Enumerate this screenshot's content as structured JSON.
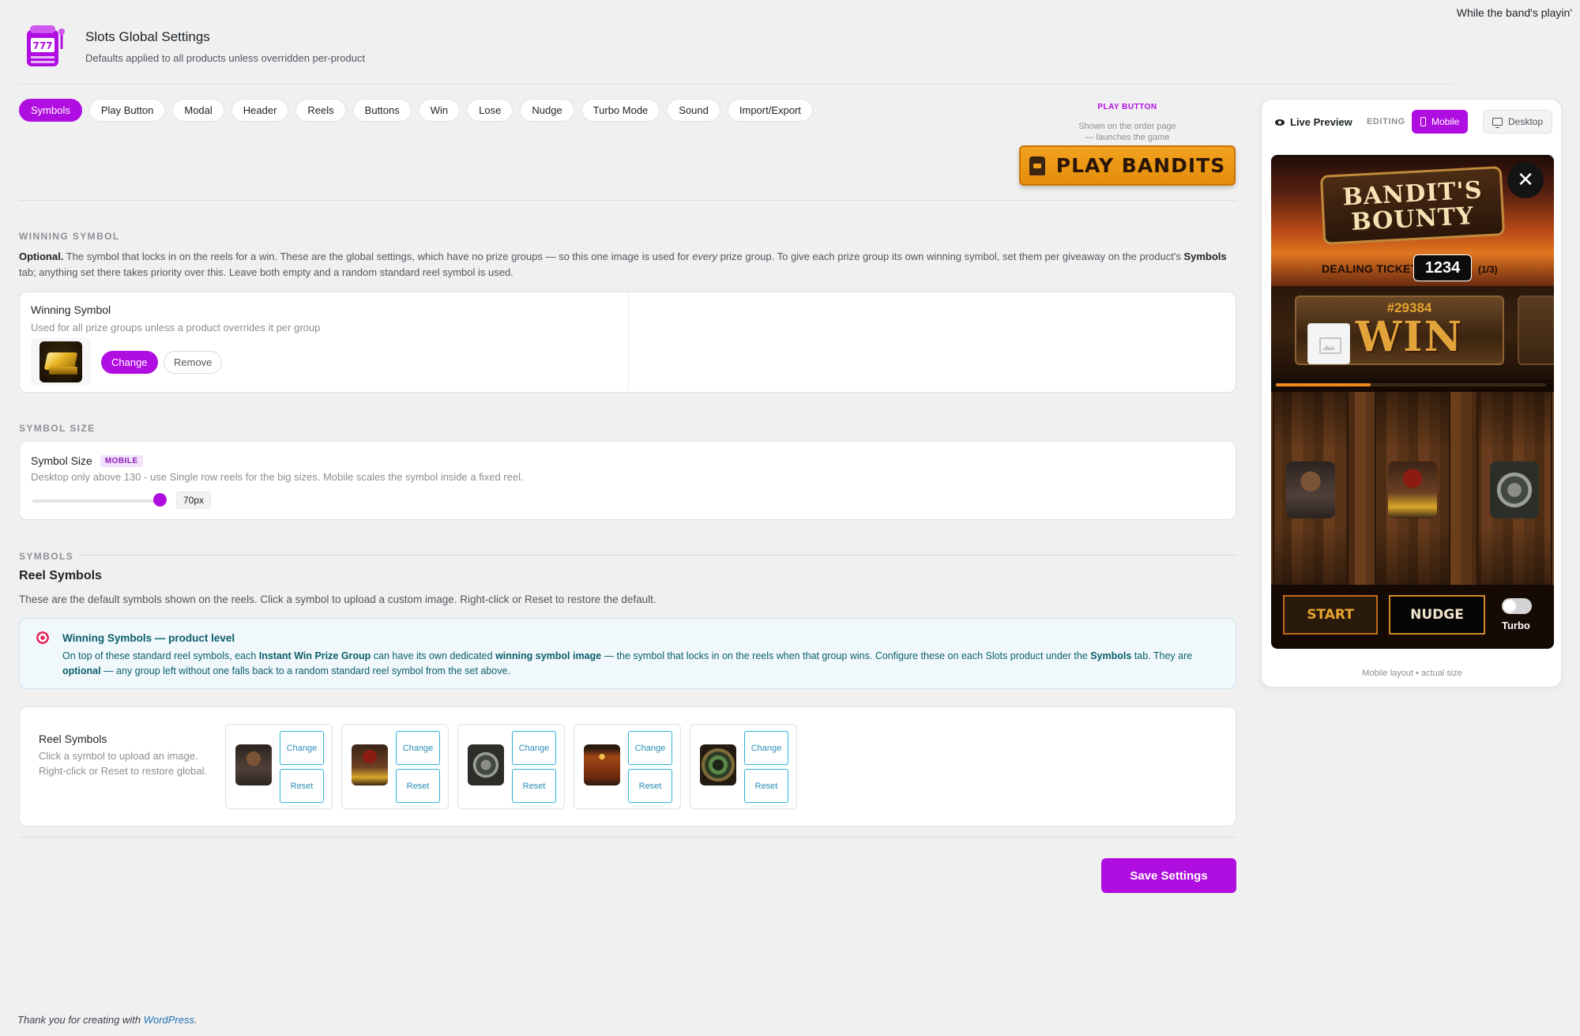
{
  "top_right_text": "While the band's playin'",
  "header": {
    "title": "Slots Global Settings",
    "subtitle": "Defaults applied to all products unless overridden per-product",
    "logo_icon": "slot-machine-icon",
    "logo_digits": "777"
  },
  "tabs": [
    {
      "label": "Symbols",
      "active": true
    },
    {
      "label": "Play Button",
      "active": false
    },
    {
      "label": "Modal",
      "active": false
    },
    {
      "label": "Header",
      "active": false
    },
    {
      "label": "Reels",
      "active": false
    },
    {
      "label": "Buttons",
      "active": false
    },
    {
      "label": "Win",
      "active": false
    },
    {
      "label": "Lose",
      "active": false
    },
    {
      "label": "Nudge",
      "active": false
    },
    {
      "label": "Turbo Mode",
      "active": false
    },
    {
      "label": "Sound",
      "active": false
    },
    {
      "label": "Import/Export",
      "active": false
    }
  ],
  "play_button_preview": {
    "label": "PLAY BUTTON",
    "desc_line1": "Shown on the order page",
    "desc_line2": "— launches the game",
    "button_text": "PLAY BANDITS",
    "icon": "ticket-icon"
  },
  "winning_symbol": {
    "section_label": "WINNING SYMBOL",
    "desc_optional": "Optional.",
    "desc_part1": " The symbol that locks in on the reels for a win. These are the global settings, which have no prize groups — so this one image is used for ",
    "desc_every": "every",
    "desc_part2": " prize group. To give each prize group its own winning symbol, set them per giveaway on the product's ",
    "desc_symbols": "Symbols",
    "desc_part3": " tab; anything set there takes priority over this. Leave both empty and a random standard reel symbol is used.",
    "card_title": "Winning Symbol",
    "card_hint": "Used for all prize groups unless a product overrides it per group",
    "image_icon": "gold-bar-icon",
    "change_label": "Change",
    "remove_label": "Remove"
  },
  "symbol_size": {
    "section_label": "SYMBOL SIZE",
    "card_title": "Symbol Size",
    "badge": "MOBILE",
    "hint": "Desktop only above 130 - use Single row reels for the big sizes. Mobile scales the symbol inside a fixed reel.",
    "value": 70,
    "value_label": "70px"
  },
  "symbols": {
    "section_label": "SYMBOLS",
    "heading": "Reel Symbols",
    "desc": "These are the default symbols shown on the reels. Click a symbol to upload a custom image. Right-click or Reset to restore the default.",
    "info": {
      "icon": "target-icon",
      "title": "Winning Symbols — product level",
      "t1": "On top of these standard reel symbols, each ",
      "b1": "Instant Win Prize Group",
      "t2": " can have its own dedicated ",
      "b2": "winning symbol image",
      "t3": " — the symbol that locks in on the reels when that group wins. Configure these on each Slots product under the ",
      "b3": "Symbols",
      "t4": " tab. They are ",
      "b4": "optional",
      "t5": " — any group left without one falls back to a random standard reel symbol from the set above."
    },
    "card_title": "Reel Symbols",
    "card_hint_line1": "Click a symbol to upload an image.",
    "card_hint_line2": "Right-click or Reset to restore global.",
    "items": [
      {
        "icon": "sheriff-icon",
        "change": "Change",
        "reset": "Reset"
      },
      {
        "icon": "wild-outlaw-icon",
        "change": "Change",
        "reset": "Reset"
      },
      {
        "icon": "safe-icon",
        "change": "Change",
        "reset": "Reset"
      },
      {
        "icon": "dynamite-icon",
        "change": "Change",
        "reset": "Reset"
      },
      {
        "icon": "horseshoe-icon",
        "change": "Change",
        "reset": "Reset"
      }
    ]
  },
  "save_label": "Save Settings",
  "footer": {
    "text": "Thank you for creating with ",
    "link": "WordPress",
    "period": "."
  },
  "preview": {
    "live_label": "Live Preview",
    "editing_label": "EDITING",
    "mobile_label": "Mobile",
    "desktop_label": "Desktop",
    "footer": "Mobile layout • actual size",
    "game": {
      "logo_line1": "BANDIT'S",
      "logo_line2": "BOUNTY",
      "dealing_label": "DEALING TICKET",
      "ticket_number": "1234",
      "ticket_count": "(1/3)",
      "ticket_id": "#29384",
      "win_text": "WIN",
      "progress": 0.35,
      "reel_symbols": [
        "sheriff-icon",
        "wild-outlaw-icon",
        "safe-icon"
      ],
      "start_label": "START",
      "nudge_label": "NUDGE",
      "turbo_label": "Turbo",
      "turbo_on": false
    }
  }
}
